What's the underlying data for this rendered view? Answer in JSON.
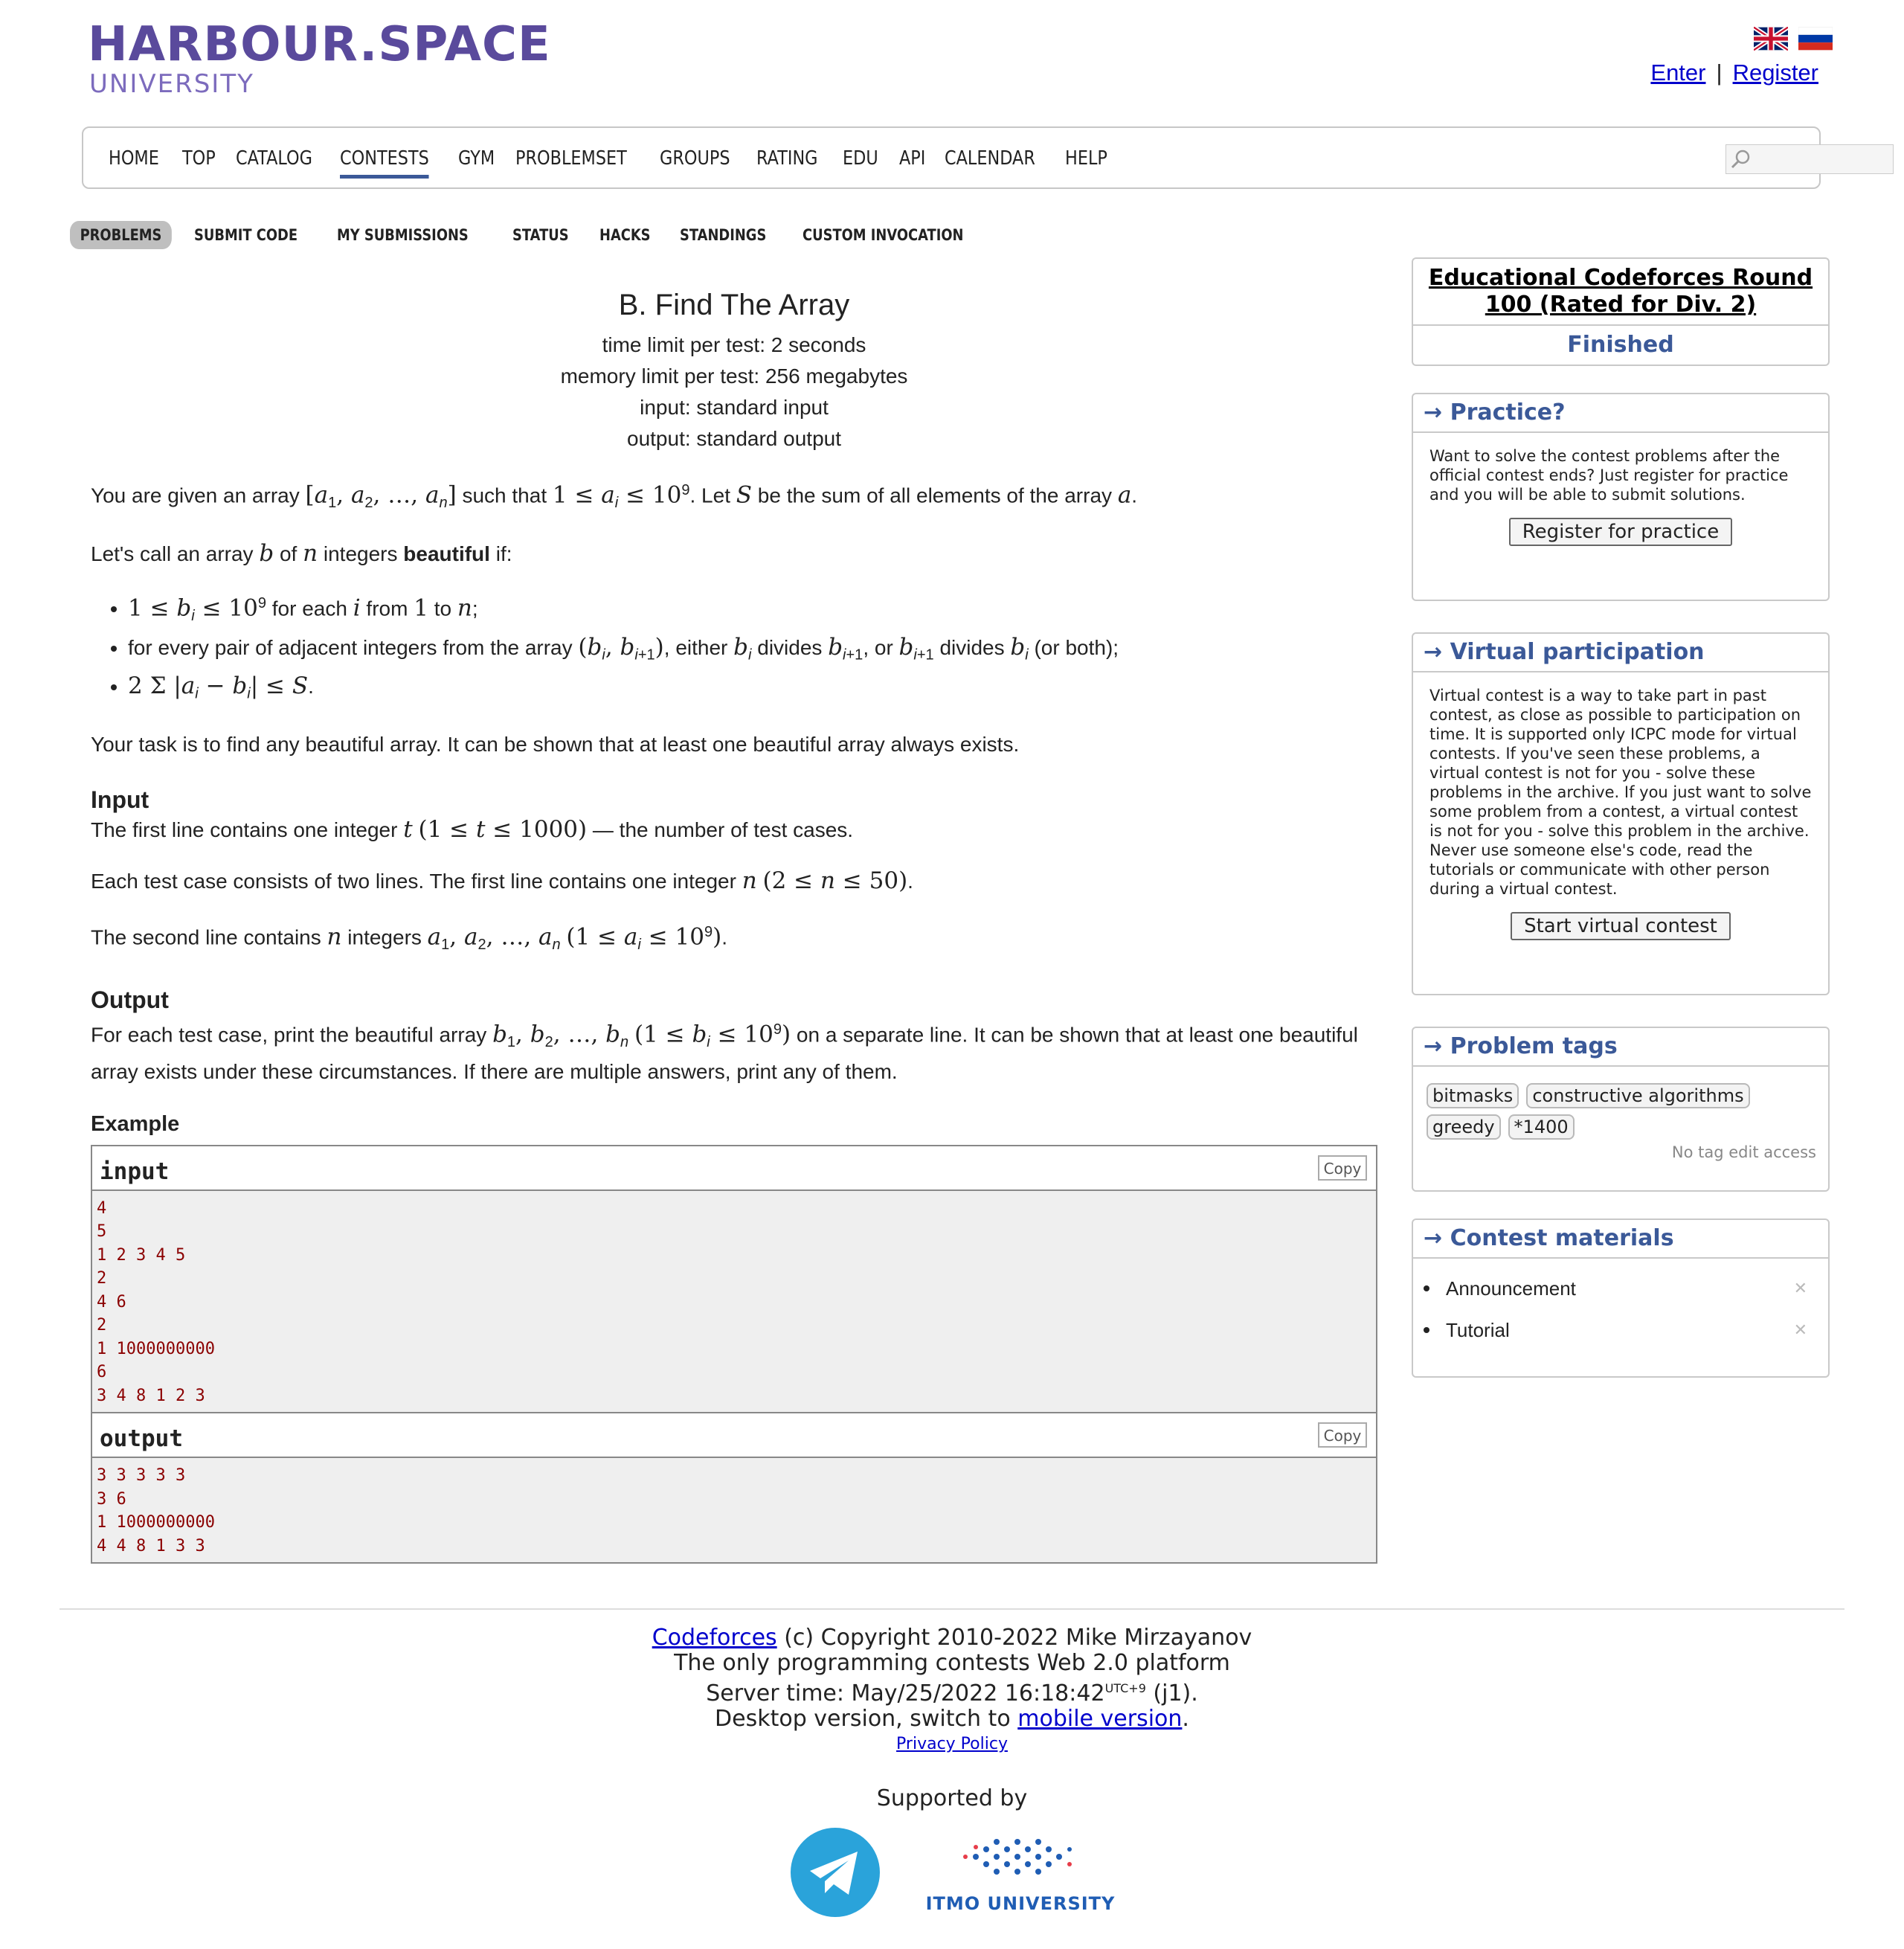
{
  "header": {
    "logo_main": "HARBOUR.SPACE",
    "logo_sub": "UNIVERSITY",
    "enter": "Enter",
    "separator": "|",
    "register": "Register"
  },
  "nav": {
    "items": [
      "HOME",
      "TOP",
      "CATALOG",
      "CONTESTS",
      "GYM",
      "PROBLEMSET",
      "GROUPS",
      "RATING",
      "EDU",
      "API",
      "CALENDAR",
      "HELP"
    ],
    "active": "CONTESTS"
  },
  "second_nav": {
    "items": [
      "PROBLEMS",
      "SUBMIT CODE",
      "MY SUBMISSIONS",
      "STATUS",
      "HACKS",
      "STANDINGS",
      "CUSTOM INVOCATION"
    ],
    "active": "PROBLEMS"
  },
  "problem": {
    "title": "B. Find The Array",
    "time_limit": "time limit per test: 2 seconds",
    "memory_limit": "memory limit per test: 256 megabytes",
    "input": "input: standard input",
    "output": "output: standard output",
    "task": "Your task is to find any beautiful array. It can be shown that at least one beautiful array always exists.",
    "input_title": "Input",
    "output_title": "Output",
    "output_text": "on a separate line. It can be shown that at least one beautiful array exists under these circumstances. If there are multiple answers, print any of them.",
    "example_title": "Example",
    "sample_input_label": "input",
    "sample_output_label": "output",
    "copy_label": "Copy",
    "sample_input": "4\n5\n1 2 3 4 5\n2\n4 6\n2\n1 1000000000\n6\n3 4 8 1 2 3",
    "sample_output": "3 3 3 3 3\n3 6\n1 1000000000\n4 4 8 1 3 3"
  },
  "sidebar": {
    "contest_name": "Educational Codeforces Round 100 (Rated for Div. 2)",
    "contest_status": "Finished",
    "practice_title": "→ Practice?",
    "practice_text": "Want to solve the contest problems after the official contest ends? Just register for practice and you will be able to submit solutions.",
    "practice_button": "Register for practice",
    "virtual_title": "→ Virtual participation",
    "virtual_text": "Virtual contest is a way to take part in past contest, as close as possible to participation on time. It is supported only ICPC mode for virtual contests. If you've seen these problems, a virtual contest is not for you - solve these problems in the archive. If you just want to solve some problem from a contest, a virtual contest is not for you - solve this problem in the archive. Never use someone else's code, read the tutorials or communicate with other person during a virtual contest.",
    "virtual_button": "Start virtual contest",
    "tags_title": "→ Problem tags",
    "tags": [
      "bitmasks",
      "constructive algorithms",
      "greedy",
      "*1400"
    ],
    "tags_note": "No tag edit access",
    "materials_title": "→ Contest materials",
    "materials": [
      "Announcement",
      "Tutorial"
    ]
  },
  "footer": {
    "codeforces": "Codeforces",
    "copyright": "(c) Copyright 2010-2022 Mike Mirzayanov",
    "platform": "The only programming contests Web 2.0 platform",
    "server_time_prefix": "Server time: May/25/2022 16:18:42",
    "utc": "UTC+9",
    "server_time_suffix": "(j1).",
    "desktop_prefix": "Desktop version, switch to",
    "mobile": "mobile version",
    "privacy": "Privacy Policy",
    "supported_by": "Supported by",
    "itmo": "ITMO UNIVERSITY"
  },
  "colors": {
    "accent": "#3b5998",
    "logo": "#5a4a9c",
    "sample_text": "#8b0000"
  }
}
